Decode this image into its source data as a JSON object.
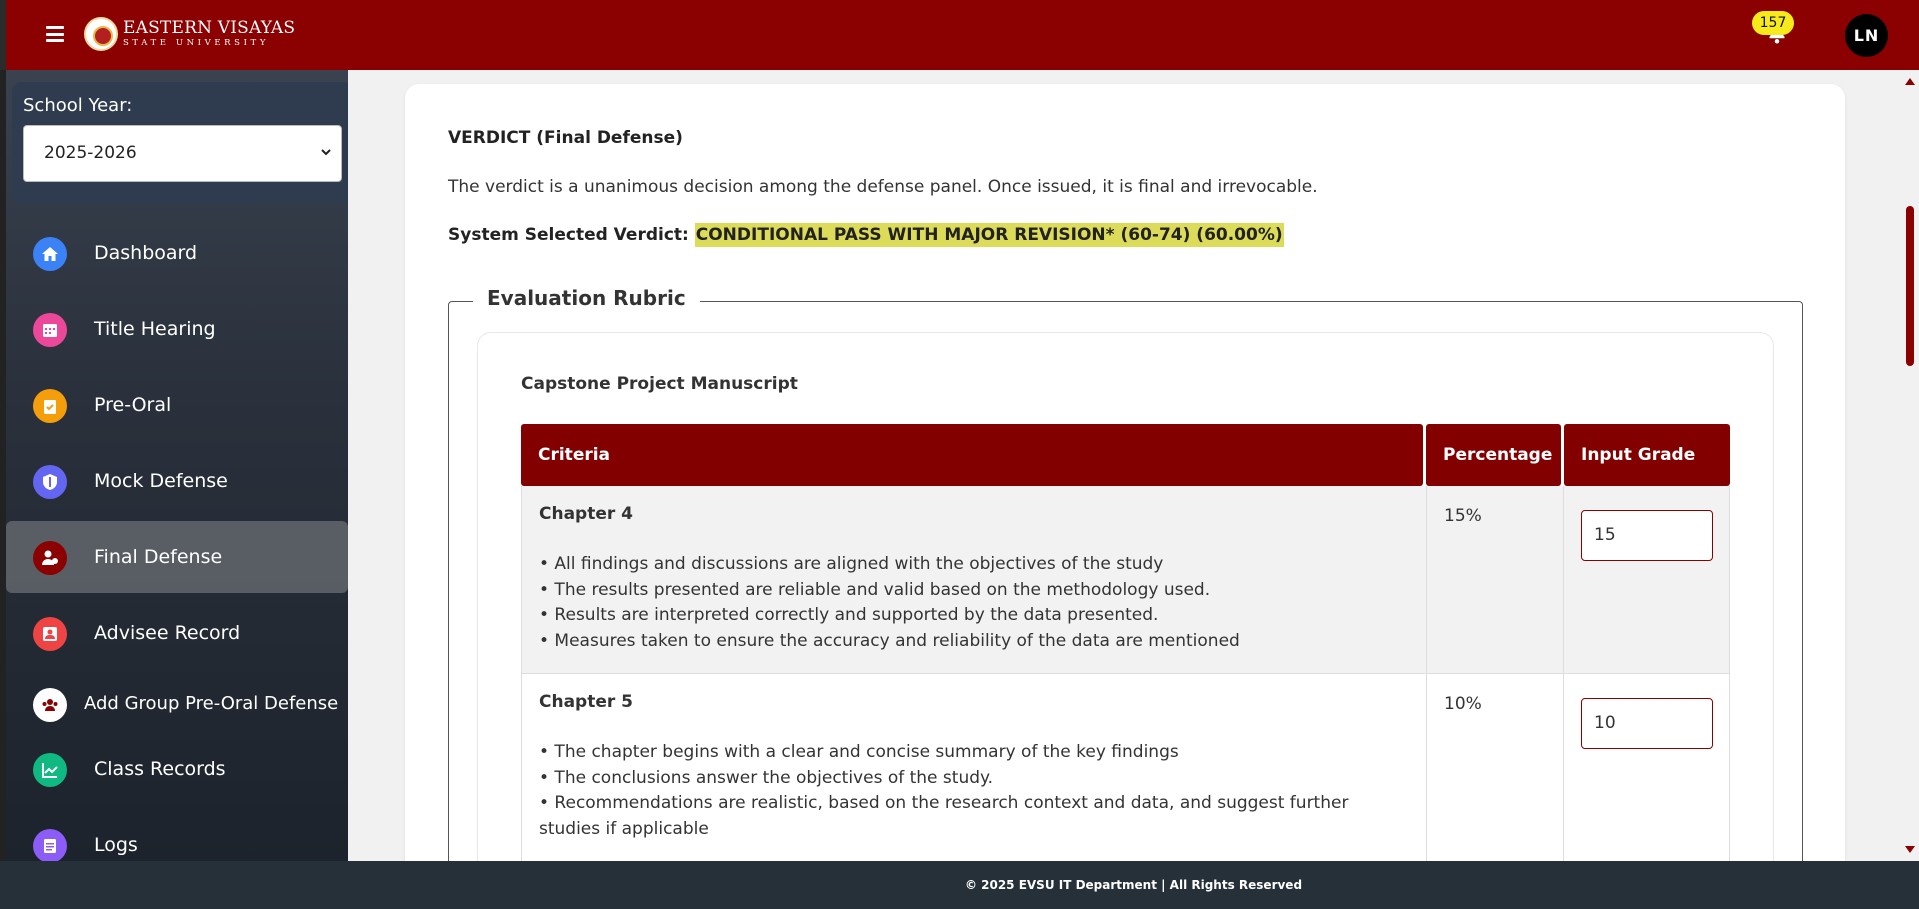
{
  "header": {
    "brand_name": "EASTERN VISAYAS",
    "brand_sub": "STATE UNIVERSITY",
    "notification_count": "157",
    "avatar_initials": "LN",
    "color": "#8b0000"
  },
  "sidebar": {
    "school_year_label": "School Year:",
    "school_year_value": "2025-2026",
    "items": [
      {
        "label": "Dashboard",
        "icon": "home-icon",
        "color": "#3b82f6"
      },
      {
        "label": "Title Hearing",
        "icon": "calendar-icon",
        "color": "#ec4899"
      },
      {
        "label": "Pre-Oral",
        "icon": "clipboard-check-icon",
        "color": "#f59e0b"
      },
      {
        "label": "Mock Defense",
        "icon": "shield-icon",
        "color": "#6366f1"
      },
      {
        "label": "Final Defense",
        "icon": "user-check-icon",
        "color": "#8b0000",
        "active": true
      },
      {
        "label": "Advisee Record",
        "icon": "graduate-icon",
        "color": "#ef4444"
      },
      {
        "label": "Add Group Pre-Oral Defense",
        "icon": "users-icon",
        "color": "#ffffff"
      },
      {
        "label": "Class Records",
        "icon": "chart-line-icon",
        "color": "#10b981"
      },
      {
        "label": "Logs",
        "icon": "file-list-icon",
        "color": "#8b5cf6"
      }
    ]
  },
  "verdict": {
    "title": "VERDICT (Final Defense)",
    "description": "The verdict is a unanimous decision among the defense panel. Once issued, it is final and irrevocable.",
    "system_label": "System Selected Verdict:",
    "system_value": "CONDITIONAL PASS WITH MAJOR REVISION* (60-74) (60.00%)"
  },
  "rubric": {
    "legend": "Evaluation Rubric",
    "section_title": "Capstone Project Manuscript",
    "columns": [
      "Criteria",
      "Percentage",
      "Input Grade"
    ],
    "rows": [
      {
        "name": "Chapter 4",
        "points": [
          "• All findings and discussions are aligned with the objectives of the study",
          "• The results presented are reliable and valid based on the methodology used.",
          "• Results are interpreted correctly and supported by the data presented.",
          "• Measures taken to ensure the accuracy and reliability of the data are mentioned"
        ],
        "percentage": "15%",
        "grade": "15"
      },
      {
        "name": "Chapter 5",
        "points": [
          "• The chapter begins with a clear and concise summary of the key findings",
          "• The conclusions answer the objectives of the study.",
          "• Recommendations are realistic, based on the research context and data, and suggest further studies if applicable"
        ],
        "percentage": "10%",
        "grade": "10"
      }
    ]
  },
  "footer": {
    "text": "© 2025 EVSU IT Department | All Rights Reserved"
  }
}
